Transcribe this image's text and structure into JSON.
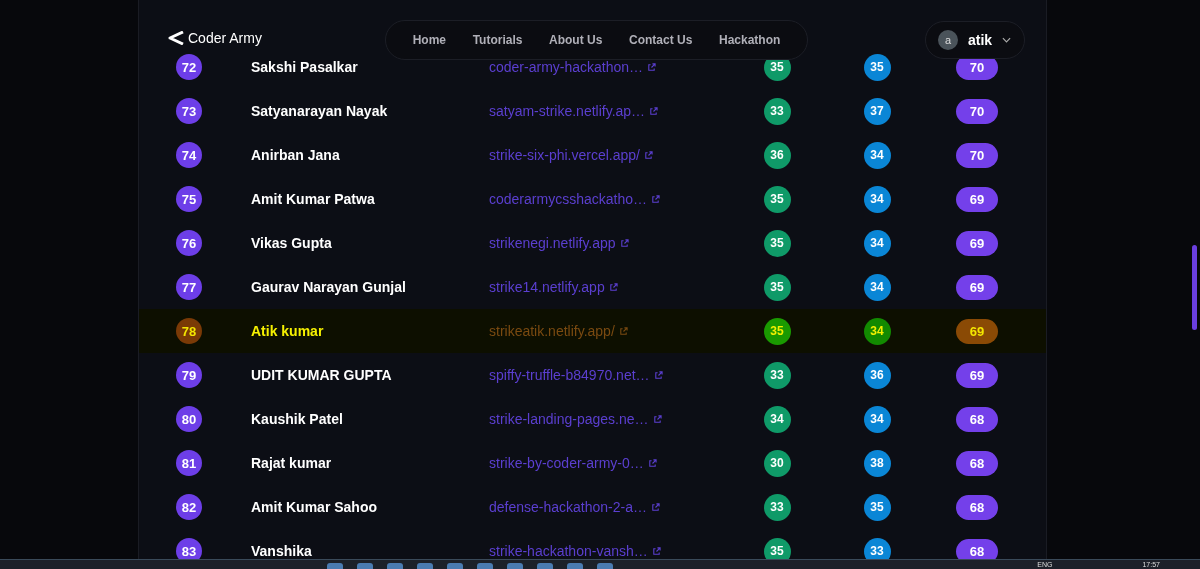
{
  "header": {
    "logo": "Coder Army",
    "nav": [
      "Home",
      "Tutorials",
      "About Us",
      "Contact Us",
      "Hackathon"
    ],
    "user": {
      "avatar": "a",
      "name": "atik"
    }
  },
  "rows": [
    {
      "rank": "72",
      "name": "Sakshi Pasalkar",
      "link": "coder-army-hackathon…",
      "score_1": "35",
      "score_2": "35",
      "total": "70",
      "highlighted": false
    },
    {
      "rank": "73",
      "name": "Satyanarayan Nayak",
      "link": "satyam-strike.netlify.ap…",
      "score_1": "33",
      "score_2": "37",
      "total": "70",
      "highlighted": false
    },
    {
      "rank": "74",
      "name": "Anirban Jana",
      "link": "strike-six-phi.vercel.app/",
      "score_1": "36",
      "score_2": "34",
      "total": "70",
      "highlighted": false
    },
    {
      "rank": "75",
      "name": "Amit Kumar Patwa",
      "link": "coderarmycsshackatho…",
      "score_1": "35",
      "score_2": "34",
      "total": "69",
      "highlighted": false
    },
    {
      "rank": "76",
      "name": "Vikas Gupta",
      "link": "strikenegi.netlify.app",
      "score_1": "35",
      "score_2": "34",
      "total": "69",
      "highlighted": false
    },
    {
      "rank": "77",
      "name": "Gaurav Narayan Gunjal",
      "link": "strike14.netlify.app",
      "score_1": "35",
      "score_2": "34",
      "total": "69",
      "highlighted": false
    },
    {
      "rank": "78",
      "name": "Atik kumar",
      "link": "strikeatik.netlify.app/",
      "score_1": "35",
      "score_2": "34",
      "total": "69",
      "highlighted": true
    },
    {
      "rank": "79",
      "name": "UDIT KUMAR GUPTA",
      "link": "spiffy-truffle-b84970.net…",
      "score_1": "33",
      "score_2": "36",
      "total": "69",
      "highlighted": false
    },
    {
      "rank": "80",
      "name": "Kaushik Patel",
      "link": "strike-landing-pages.ne…",
      "score_1": "34",
      "score_2": "34",
      "total": "68",
      "highlighted": false
    },
    {
      "rank": "81",
      "name": "Rajat kumar",
      "link": "strike-by-coder-army-0…",
      "score_1": "30",
      "score_2": "38",
      "total": "68",
      "highlighted": false
    },
    {
      "rank": "82",
      "name": "Amit Kumar Sahoo",
      "link": "defense-hackathon-2-a…",
      "score_1": "33",
      "score_2": "35",
      "total": "68",
      "highlighted": false
    },
    {
      "rank": "83",
      "name": "Vanshika",
      "link": "strike-hackathon-vansh…",
      "score_1": "35",
      "score_2": "33",
      "total": "68",
      "highlighted": false
    }
  ],
  "taskbar": {
    "language": "ENG",
    "time": "17:57"
  }
}
